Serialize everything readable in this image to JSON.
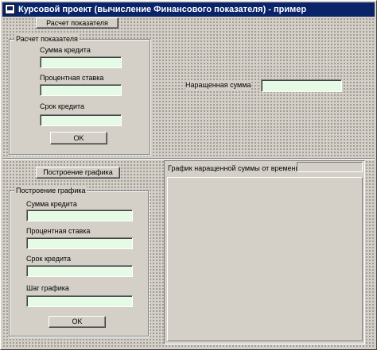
{
  "window": {
    "title": "Курсовой проект (вычисление Финансового показателя) - пример"
  },
  "top": {
    "calc_button": "Расчет показателя",
    "group_title": "Расчет показателя",
    "fields": [
      {
        "label": "Сумма кредита",
        "value": ""
      },
      {
        "label": "Процентная ставка",
        "value": ""
      },
      {
        "label": "Срок кредита",
        "value": ""
      }
    ],
    "ok_button": "OK",
    "result_label": "Наращенная сумма",
    "result_value": ""
  },
  "bottom": {
    "plot_button": "Построение графика",
    "group_title": "Построение графика",
    "fields": [
      {
        "label": "Сумма кредита",
        "value": ""
      },
      {
        "label": "Процентная ставка",
        "value": ""
      },
      {
        "label": "Срок кредита",
        "value": ""
      },
      {
        "label": "Шаг графика",
        "value": ""
      }
    ],
    "ok_button": "OK",
    "chart_title": "График наращенной суммы от времени"
  },
  "colors": {
    "titlebar": "#0a246a",
    "edit_background": "#e6fbe6",
    "face": "#d4d0c8"
  }
}
